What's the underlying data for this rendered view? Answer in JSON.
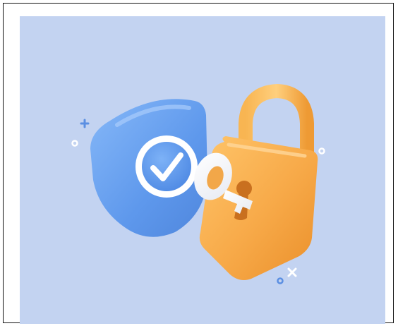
{
  "illustration": {
    "subject": "security-shield-padlock-key",
    "icons": [
      "shield-icon",
      "checkmark-icon",
      "padlock-icon",
      "key-icon",
      "sparkle-plus-icon",
      "sparkle-ring-icon"
    ],
    "colors": {
      "background": "#c3d3f1",
      "shield": "#6ea6f2",
      "check_badge": "#ffffff",
      "padlock": "#f7a948",
      "padlock_shackle": "#f5a13a",
      "key": "#ffffff"
    }
  }
}
